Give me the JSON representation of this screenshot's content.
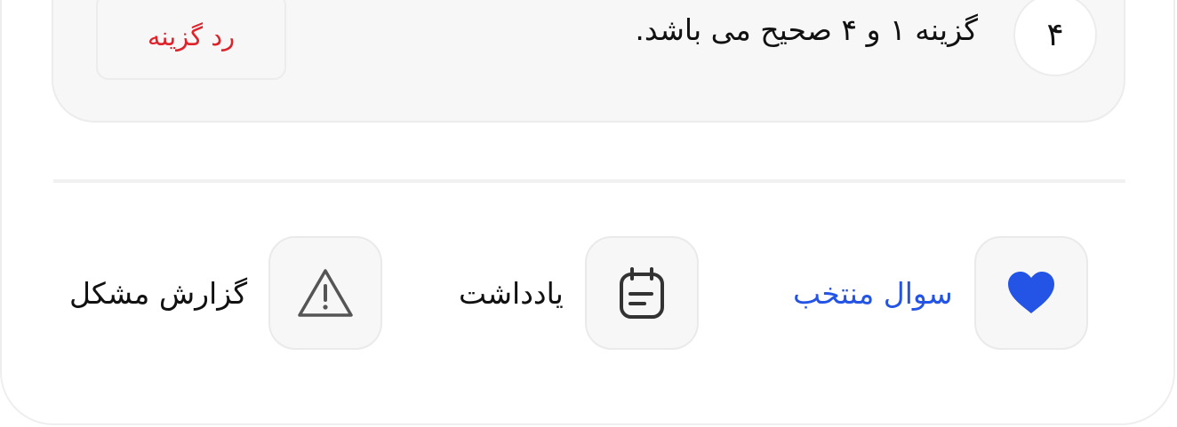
{
  "option": {
    "number": "۴",
    "text": "گزینه ۱ و ۴ صحیح می باشد.",
    "reject_label": "رد گزینه"
  },
  "actions": {
    "favorite_label": "سوال منتخب",
    "note_label": "یادداشت",
    "report_label": "گزارش مشکل"
  },
  "icons": {
    "favorite": "heart-icon",
    "note": "notepad-icon",
    "report": "warning-triangle-icon"
  },
  "colors": {
    "accent_blue": "#2454e6",
    "reject_red": "#e0232b",
    "box_background": "#f7f7f7",
    "border": "#ececec"
  }
}
